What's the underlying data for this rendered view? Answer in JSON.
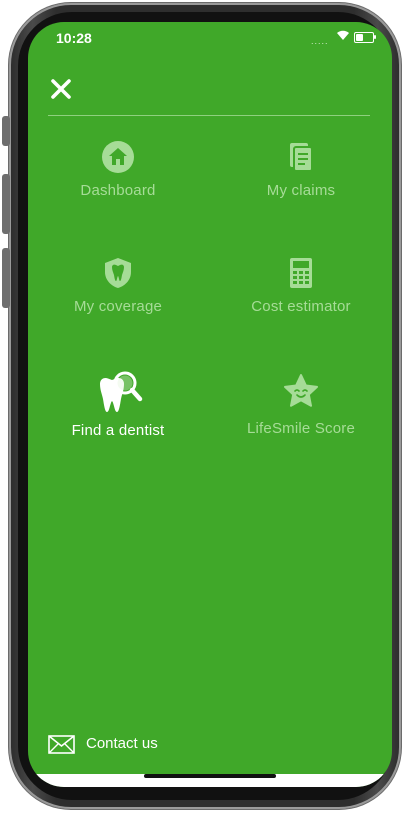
{
  "status_bar": {
    "time": "10:28",
    "signal": "....."
  },
  "menu": {
    "items": [
      {
        "label": "Dashboard",
        "icon": "home-icon",
        "active": false
      },
      {
        "label": "My claims",
        "icon": "documents-icon",
        "active": false
      },
      {
        "label": "My coverage",
        "icon": "tooth-shield-icon",
        "active": false
      },
      {
        "label": "Cost estimator",
        "icon": "calculator-icon",
        "active": false
      },
      {
        "label": "Find a dentist",
        "icon": "tooth-search-icon",
        "active": true
      },
      {
        "label": "LifeSmile Score",
        "icon": "smiling-star-icon",
        "active": false
      }
    ]
  },
  "footer": {
    "contact_label": "Contact us"
  },
  "colors": {
    "background": "#40a829",
    "inactive_text": "#a6dc97",
    "active_text": "#ffffff"
  }
}
